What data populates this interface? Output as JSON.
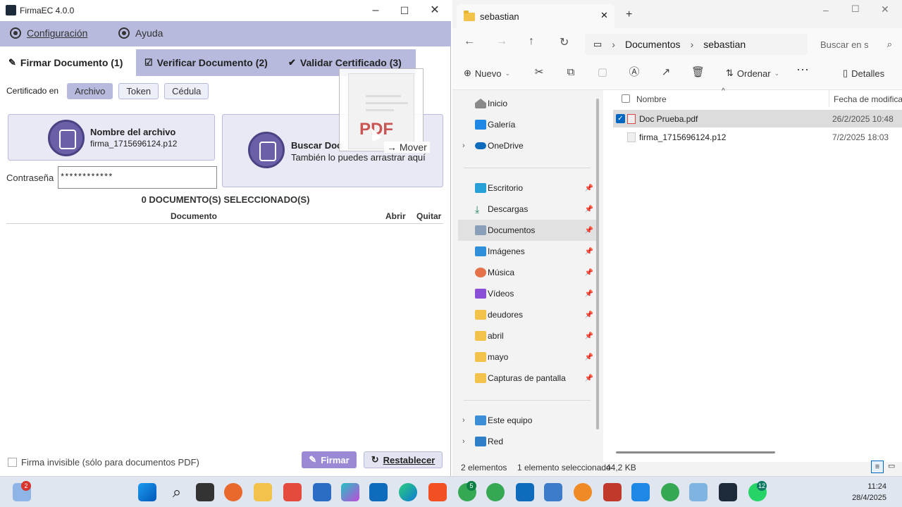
{
  "firma": {
    "title": "FirmaEC 4.0.0",
    "menu": {
      "config": "Configuración",
      "help": "Ayuda"
    },
    "tabs": [
      "Firmar Documento (1)",
      "Verificar Documento (2)",
      "Validar Certificado (3)"
    ],
    "cert_label": "Certificado en",
    "cert_options": [
      "Archivo",
      "Token",
      "Cédula"
    ],
    "cert_selected": "Archivo",
    "file_card": {
      "title": "Nombre del archivo",
      "value": "firma_1715696124.p12"
    },
    "search_card": {
      "title": "Buscar Doc",
      "subtitle": "También lo puedes arrastrar aquí"
    },
    "password_label": "Contraseña",
    "password_value": "************",
    "selected_title": "0 DOCUMENTO(S) SELECCIONADO(S)",
    "table_headers": {
      "doc": "Documento",
      "open": "Abrir",
      "remove": "Quitar"
    },
    "invisible_label": "Firma invisible (sólo para documentos PDF)",
    "sign_button": "Firmar",
    "reset_button": "Restablecer",
    "drag_ghost_text": "PDF",
    "drag_action": "Mover",
    "colors": {
      "accent": "#b7b9dd",
      "icon": "#6b5fa8",
      "sign_btn": "#9b89d6"
    }
  },
  "explorer": {
    "tab_title": "sebastian",
    "breadcrumb": [
      "Documentos",
      "sebastian"
    ],
    "search_placeholder": "Buscar en s",
    "toolbar": {
      "new": "Nuevo",
      "sort": "Ordenar",
      "details": "Detalles"
    },
    "nav": {
      "home": "Inicio",
      "gallery": "Galería",
      "onedrive": "OneDrive",
      "desktop": "Escritorio",
      "downloads": "Descargas",
      "documents": "Documentos",
      "pictures": "Imágenes",
      "music": "Música",
      "videos": "Vídeos",
      "deudores": "deudores",
      "abril": "abril",
      "mayo": "mayo",
      "captures": "Capturas de pantalla",
      "thispc": "Este equipo",
      "network": "Red"
    },
    "columns": {
      "name": "Nombre",
      "date": "Fecha de modificac"
    },
    "files": [
      {
        "name": "Doc Prueba.pdf",
        "date": "26/2/2025 10:48",
        "selected": true
      },
      {
        "name": "firma_1715696124.p12",
        "date": "7/2/2025 18:03",
        "selected": false
      }
    ],
    "status": {
      "count": "2 elementos",
      "selected": "1 elemento seleccionado",
      "size": "44,2 KB"
    }
  },
  "taskbar": {
    "widget_badge": "2",
    "edge_badge": "5",
    "whatsapp_badge": "12",
    "time": "11:24",
    "date": "28/4/2025"
  }
}
